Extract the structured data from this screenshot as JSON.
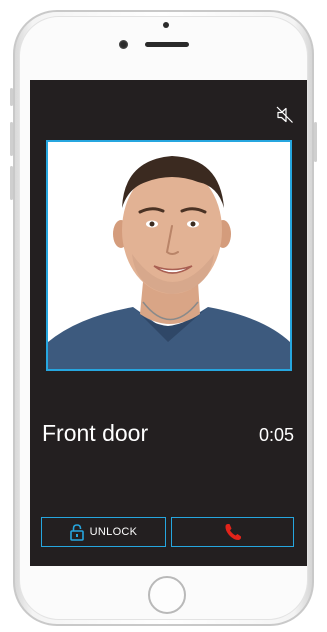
{
  "call": {
    "door_name": "Front door",
    "duration": "0:05"
  },
  "controls": {
    "unlock_label": "UNLOCK",
    "unlock_icon": "padlock-icon",
    "hangup_icon": "phone-hangup-icon",
    "mute_icon": "speaker-muted-icon"
  },
  "colors": {
    "accent": "#26a6df",
    "screen_bg": "#231f20",
    "hangup": "#e2231a"
  }
}
